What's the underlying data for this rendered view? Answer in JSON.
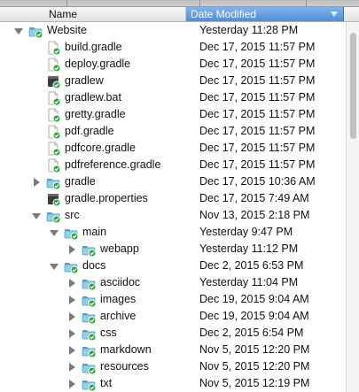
{
  "columns": {
    "name": "Name",
    "date_modified": "Date Modified"
  },
  "colors": {
    "folder": "#8fd0e8",
    "folder_dark": "#4ea3c9",
    "badge": "#27a53a",
    "header_selected": "#5b97dd"
  },
  "rows": [
    {
      "name": "Website",
      "date": "Yesterday 11:28 PM",
      "depth": 0,
      "kind": "folder",
      "toggle": "open",
      "icon": "folder-synced-icon"
    },
    {
      "name": "build.gradle",
      "date": "Dec 17, 2015 11:57 PM",
      "depth": 1,
      "kind": "file",
      "toggle": "none",
      "icon": "document-synced-icon"
    },
    {
      "name": "deploy.gradle",
      "date": "Dec 17, 2015 11:57 PM",
      "depth": 1,
      "kind": "file",
      "toggle": "none",
      "icon": "document-synced-icon"
    },
    {
      "name": "gradlew",
      "date": "Dec 17, 2015 11:57 PM",
      "depth": 1,
      "kind": "exec",
      "toggle": "none",
      "icon": "executable-synced-icon"
    },
    {
      "name": "gradlew.bat",
      "date": "Dec 17, 2015 11:57 PM",
      "depth": 1,
      "kind": "file",
      "toggle": "none",
      "icon": "document-synced-icon"
    },
    {
      "name": "gretty.gradle",
      "date": "Dec 17, 2015 11:57 PM",
      "depth": 1,
      "kind": "file",
      "toggle": "none",
      "icon": "document-synced-icon"
    },
    {
      "name": "pdf.gradle",
      "date": "Dec 17, 2015 11:57 PM",
      "depth": 1,
      "kind": "file",
      "toggle": "none",
      "icon": "document-synced-icon"
    },
    {
      "name": "pdfcore.gradle",
      "date": "Dec 17, 2015 11:57 PM",
      "depth": 1,
      "kind": "file",
      "toggle": "none",
      "icon": "document-synced-icon"
    },
    {
      "name": "pdfreference.gradle",
      "date": "Dec 17, 2015 11:57 PM",
      "depth": 1,
      "kind": "file",
      "toggle": "none",
      "icon": "document-synced-icon"
    },
    {
      "name": "gradle",
      "date": "Dec 17, 2015 10:36 AM",
      "depth": 1,
      "kind": "folder",
      "toggle": "closed",
      "icon": "folder-synced-icon"
    },
    {
      "name": "gradle.properties",
      "date": "Dec 17, 2015 7:49 AM",
      "depth": 1,
      "kind": "exec",
      "toggle": "none",
      "icon": "executable-synced-icon"
    },
    {
      "name": "src",
      "date": "Nov 13, 2015 2:18 PM",
      "depth": 1,
      "kind": "folder",
      "toggle": "open",
      "icon": "folder-synced-icon"
    },
    {
      "name": "main",
      "date": "Yesterday 9:47 PM",
      "depth": 2,
      "kind": "folder",
      "toggle": "open",
      "icon": "folder-synced-icon"
    },
    {
      "name": "webapp",
      "date": "Yesterday 11:12 PM",
      "depth": 3,
      "kind": "folder",
      "toggle": "closed",
      "icon": "folder-synced-icon"
    },
    {
      "name": "docs",
      "date": "Dec 2, 2015 6:53 PM",
      "depth": 2,
      "kind": "folder",
      "toggle": "open",
      "icon": "folder-synced-icon"
    },
    {
      "name": "asciidoc",
      "date": "Yesterday 11:04 PM",
      "depth": 3,
      "kind": "folder",
      "toggle": "closed",
      "icon": "folder-synced-icon"
    },
    {
      "name": "images",
      "date": "Dec 19, 2015 9:04 AM",
      "depth": 3,
      "kind": "folder",
      "toggle": "closed",
      "icon": "folder-synced-icon"
    },
    {
      "name": "archive",
      "date": "Dec 19, 2015 9:04 AM",
      "depth": 3,
      "kind": "folder",
      "toggle": "closed",
      "icon": "folder-synced-icon"
    },
    {
      "name": "css",
      "date": "Dec 2, 2015 6:54 PM",
      "depth": 3,
      "kind": "folder",
      "toggle": "closed",
      "icon": "folder-synced-icon"
    },
    {
      "name": "markdown",
      "date": "Nov 5, 2015 12:20 PM",
      "depth": 3,
      "kind": "folder",
      "toggle": "closed",
      "icon": "folder-synced-icon"
    },
    {
      "name": "resources",
      "date": "Nov 5, 2015 12:20 PM",
      "depth": 3,
      "kind": "folder",
      "toggle": "closed",
      "icon": "folder-synced-icon"
    },
    {
      "name": "txt",
      "date": "Nov 5, 2015 12:19 PM",
      "depth": 3,
      "kind": "folder",
      "toggle": "closed",
      "icon": "folder-synced-icon"
    }
  ]
}
